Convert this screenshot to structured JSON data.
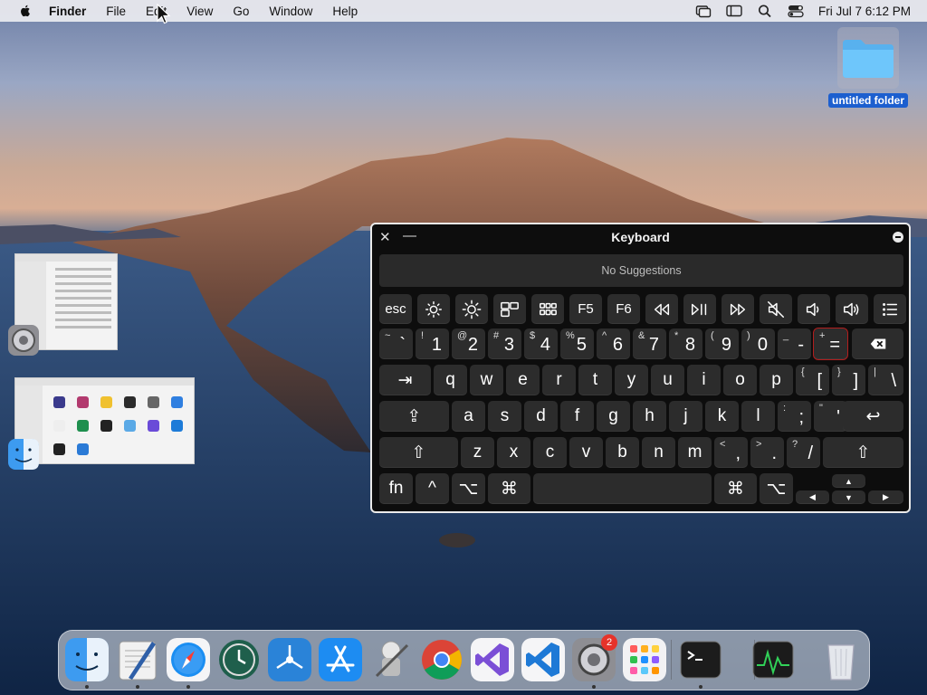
{
  "menubar": {
    "app_name": "Finder",
    "items": [
      "File",
      "Edit",
      "View",
      "Go",
      "Window",
      "Help"
    ],
    "clock": "Fri Jul 7  6:12 PM",
    "status_icons": [
      "screen-mirroring-icon",
      "display-icon",
      "spotlight-search-icon",
      "control-center-icon"
    ]
  },
  "desktop": {
    "folder_label": "untitled folder"
  },
  "thumbnails": [
    {
      "app": "System Settings"
    },
    {
      "app": "Finder"
    }
  ],
  "keyboard": {
    "title": "Keyboard",
    "suggestions": "No Suggestions",
    "fn_row": [
      "esc",
      "F5",
      "F6"
    ],
    "number_row": [
      {
        "shift": "~",
        "main": "`"
      },
      {
        "shift": "!",
        "main": "1"
      },
      {
        "shift": "@",
        "main": "2"
      },
      {
        "shift": "#",
        "main": "3"
      },
      {
        "shift": "$",
        "main": "4"
      },
      {
        "shift": "%",
        "main": "5"
      },
      {
        "shift": "^",
        "main": "6"
      },
      {
        "shift": "&",
        "main": "7"
      },
      {
        "shift": "*",
        "main": "8"
      },
      {
        "shift": "(",
        "main": "9"
      },
      {
        "shift": ")",
        "main": "0"
      },
      {
        "shift": "_",
        "main": "-"
      },
      {
        "shift": "+",
        "main": "="
      }
    ],
    "top_row": [
      "q",
      "w",
      "e",
      "r",
      "t",
      "y",
      "u",
      "i",
      "o",
      "p"
    ],
    "top_row_symbols": [
      {
        "shift": "{",
        "main": "["
      },
      {
        "shift": "}",
        "main": "]"
      },
      {
        "shift": "|",
        "main": "\\"
      }
    ],
    "home_row": [
      "a",
      "s",
      "d",
      "f",
      "g",
      "h",
      "j",
      "k",
      "l"
    ],
    "home_row_symbols": [
      {
        "shift": ":",
        "main": ";"
      },
      {
        "shift": "\"",
        "main": "'"
      }
    ],
    "bottom_row": [
      "z",
      "x",
      "c",
      "v",
      "b",
      "n",
      "m"
    ],
    "bottom_row_symbols": [
      {
        "shift": "<",
        "main": ","
      },
      {
        "shift": ">",
        "main": "."
      },
      {
        "shift": "?",
        "main": "/"
      }
    ],
    "modifiers": {
      "fn": "fn",
      "control": "^",
      "option": "⌥",
      "command": "⌘",
      "tab": "⇥",
      "caps": "⇪",
      "shift": "⇧",
      "return": "↩"
    },
    "arrows": {
      "up": "▲",
      "left": "◀",
      "down": "▼",
      "right": "▶"
    }
  },
  "dock": {
    "apps": [
      "Finder",
      "TextEdit",
      "Safari",
      "Time Machine",
      "Plasticity",
      "App Store",
      "Automator",
      "Google Chrome",
      "Visual Studio",
      "Visual Studio Code",
      "System Settings",
      "Launchpad",
      "Terminal",
      "Activity Monitor",
      "Trash"
    ],
    "system_settings_badge": "2"
  }
}
